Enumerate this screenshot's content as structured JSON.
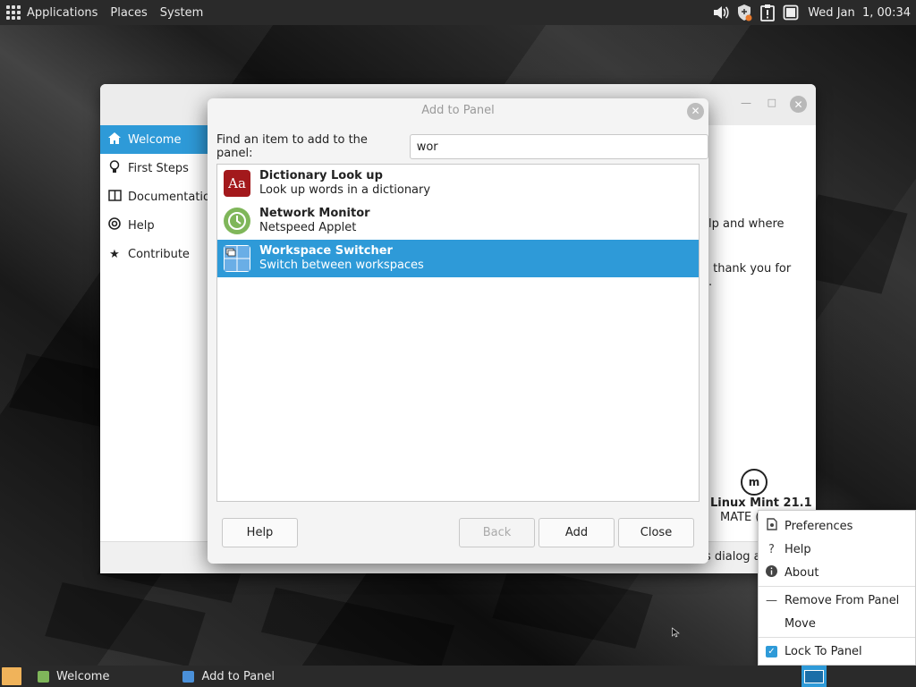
{
  "top_panel": {
    "menus": [
      "Applications",
      "Places",
      "System"
    ],
    "clock": "Wed Jan  1, 00:34",
    "tray_icons": [
      "volume-icon",
      "update-shield-icon",
      "clipboard-alert-icon",
      "display-icon"
    ]
  },
  "welcome_window": {
    "sidebar": [
      {
        "label": "Welcome",
        "icon": "home-icon"
      },
      {
        "label": "First Steps",
        "icon": "lightbulb-icon"
      },
      {
        "label": "Documentation",
        "icon": "book-icon"
      },
      {
        "label": "Help",
        "icon": "lifebuoy-icon"
      },
      {
        "label": "Contribute",
        "icon": "star-icon"
      }
    ],
    "text_fragment_1": "lp and where",
    "text_fragment_2": " thank you for",
    "text_fragment_3": ".",
    "brand": "Linux Mint 21.1",
    "edition": "MATE (",
    "footer_text": "s dialog a"
  },
  "dialog": {
    "title": "Add to Panel",
    "find_label": "Find an item to add to the panel:",
    "search_value": "wor",
    "items": [
      {
        "name": "Dictionary Look up",
        "desc": "Look up words in a dictionary",
        "icon": "dictionary-icon",
        "icon_text": "Aa"
      },
      {
        "name": "Network Monitor",
        "desc": "Netspeed Applet",
        "icon": "network-monitor-icon"
      },
      {
        "name": "Workspace Switcher",
        "desc": "Switch between workspaces",
        "icon": "workspace-switcher-icon"
      }
    ],
    "buttons": {
      "help": "Help",
      "back": "Back",
      "add": "Add",
      "close": "Close"
    }
  },
  "context_menu": {
    "items": [
      "Preferences",
      "Help",
      "About",
      "Remove From Panel",
      "Move",
      "Lock To Panel"
    ]
  },
  "taskbar": {
    "tasks": [
      {
        "label": "Welcome"
      },
      {
        "label": "Add to Panel"
      }
    ]
  },
  "colors": {
    "accent": "#2e9ad8",
    "panel": "#2a2a2a"
  }
}
